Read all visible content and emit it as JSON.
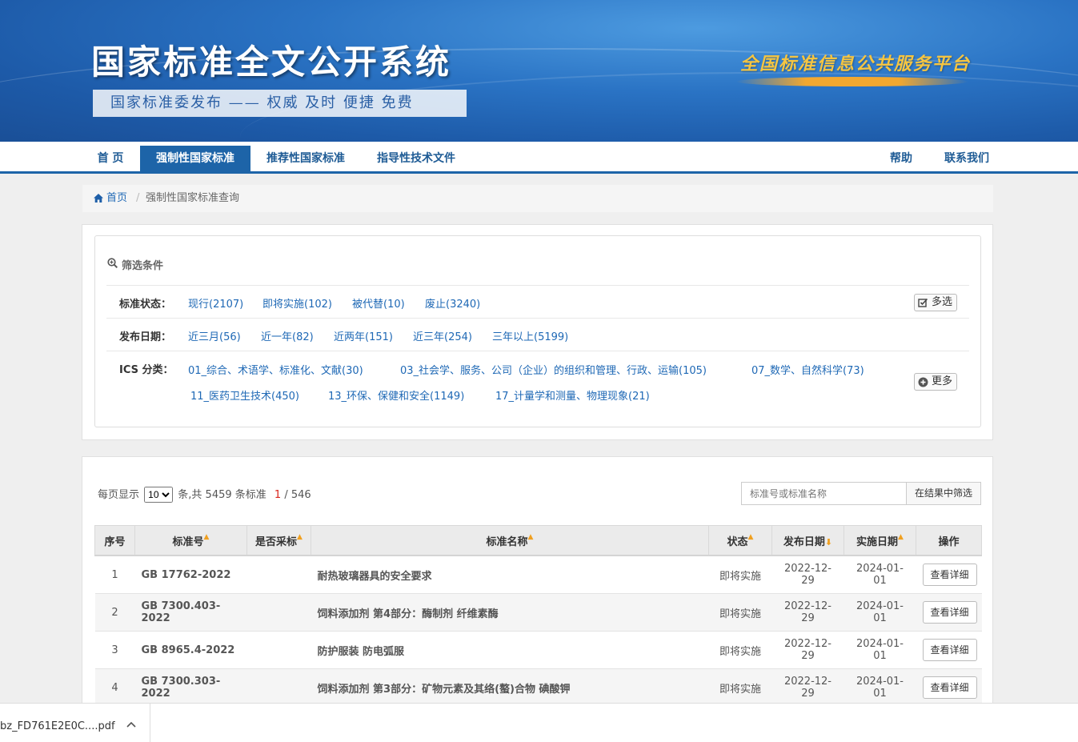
{
  "banner": {
    "title": "国家标准全文公开系统",
    "subtitle": "国家标准委发布 —— 权威 及时 便捷 免费",
    "platform": "全国标准信息公共服务平台"
  },
  "nav": {
    "items": [
      "首 页",
      "强制性国家标准",
      "推荐性国家标准",
      "指导性技术文件"
    ],
    "active": "强制性国家标准",
    "help": "帮助",
    "contact": "联系我们"
  },
  "breadcrumb": {
    "home": "首页",
    "separator": "/",
    "current": "强制性国家标准查询"
  },
  "filter": {
    "title": "筛选条件",
    "status": {
      "label": "标准状态：",
      "options": [
        "现行(2107)",
        "即将实施(102)",
        "被代替(10)",
        "废止(3240)"
      ],
      "multi_button": "多选"
    },
    "date": {
      "label": "发布日期：",
      "options": [
        "近三月(56)",
        "近一年(82)",
        "近两年(151)",
        "近三年(254)",
        "三年以上(5199)"
      ]
    },
    "ics": {
      "label": "ICS 分类：",
      "options": [
        "01_综合、术语学、标准化、文献(30)",
        "03_社会学、服务、公司（企业）的组织和管理、行政、运输(105)",
        "07_数学、自然科学(73)",
        "11_医药卫生技术(450)",
        "13_环保、保健和安全(1149)",
        "17_计量学和测量、物理现象(21)"
      ],
      "more_button": "更多"
    }
  },
  "results": {
    "per_page_label": "每页显示",
    "per_page_value": "10",
    "total_text": "条,共 5459 条标准",
    "current_page": "1",
    "total_pages": "/ 546",
    "search_placeholder": "标准号或标准名称",
    "search_button": "在结果中筛选",
    "columns": [
      "序号",
      "标准号",
      "是否采标",
      "标准名称",
      "状态",
      "发布日期",
      "实施日期",
      "操作"
    ],
    "rows": [
      {
        "no": "1",
        "code": "GB 17762-2022",
        "adopted": "",
        "name": "耐热玻璃器具的安全要求",
        "status": "即将实施",
        "pub_date": "2022-12-29",
        "impl_date": "2024-01-01",
        "action": "查看详细"
      },
      {
        "no": "2",
        "code": "GB 7300.403-2022",
        "adopted": "",
        "name": "饲料添加剂 第4部分：酶制剂 纤维素酶",
        "status": "即将实施",
        "pub_date": "2022-12-29",
        "impl_date": "2024-01-01",
        "action": "查看详细"
      },
      {
        "no": "3",
        "code": "GB 8965.4-2022",
        "adopted": "",
        "name": "防护服装 防电弧服",
        "status": "即将实施",
        "pub_date": "2022-12-29",
        "impl_date": "2024-01-01",
        "action": "查看详细"
      },
      {
        "no": "4",
        "code": "GB 7300.303-2022",
        "adopted": "",
        "name": "饲料添加剂 第3部分：矿物元素及其络(螯)合物 碘酸钾",
        "status": "即将实施",
        "pub_date": "2022-12-29",
        "impl_date": "2024-01-01",
        "action": "查看详细"
      }
    ]
  },
  "download_bar": {
    "file_name": "bz_FD761E2E0C....pdf"
  },
  "colors": {
    "brand": "#1d64a8",
    "link": "#1e68b5",
    "status": "#9a6b24",
    "sort_arrow": "#f0a020"
  }
}
